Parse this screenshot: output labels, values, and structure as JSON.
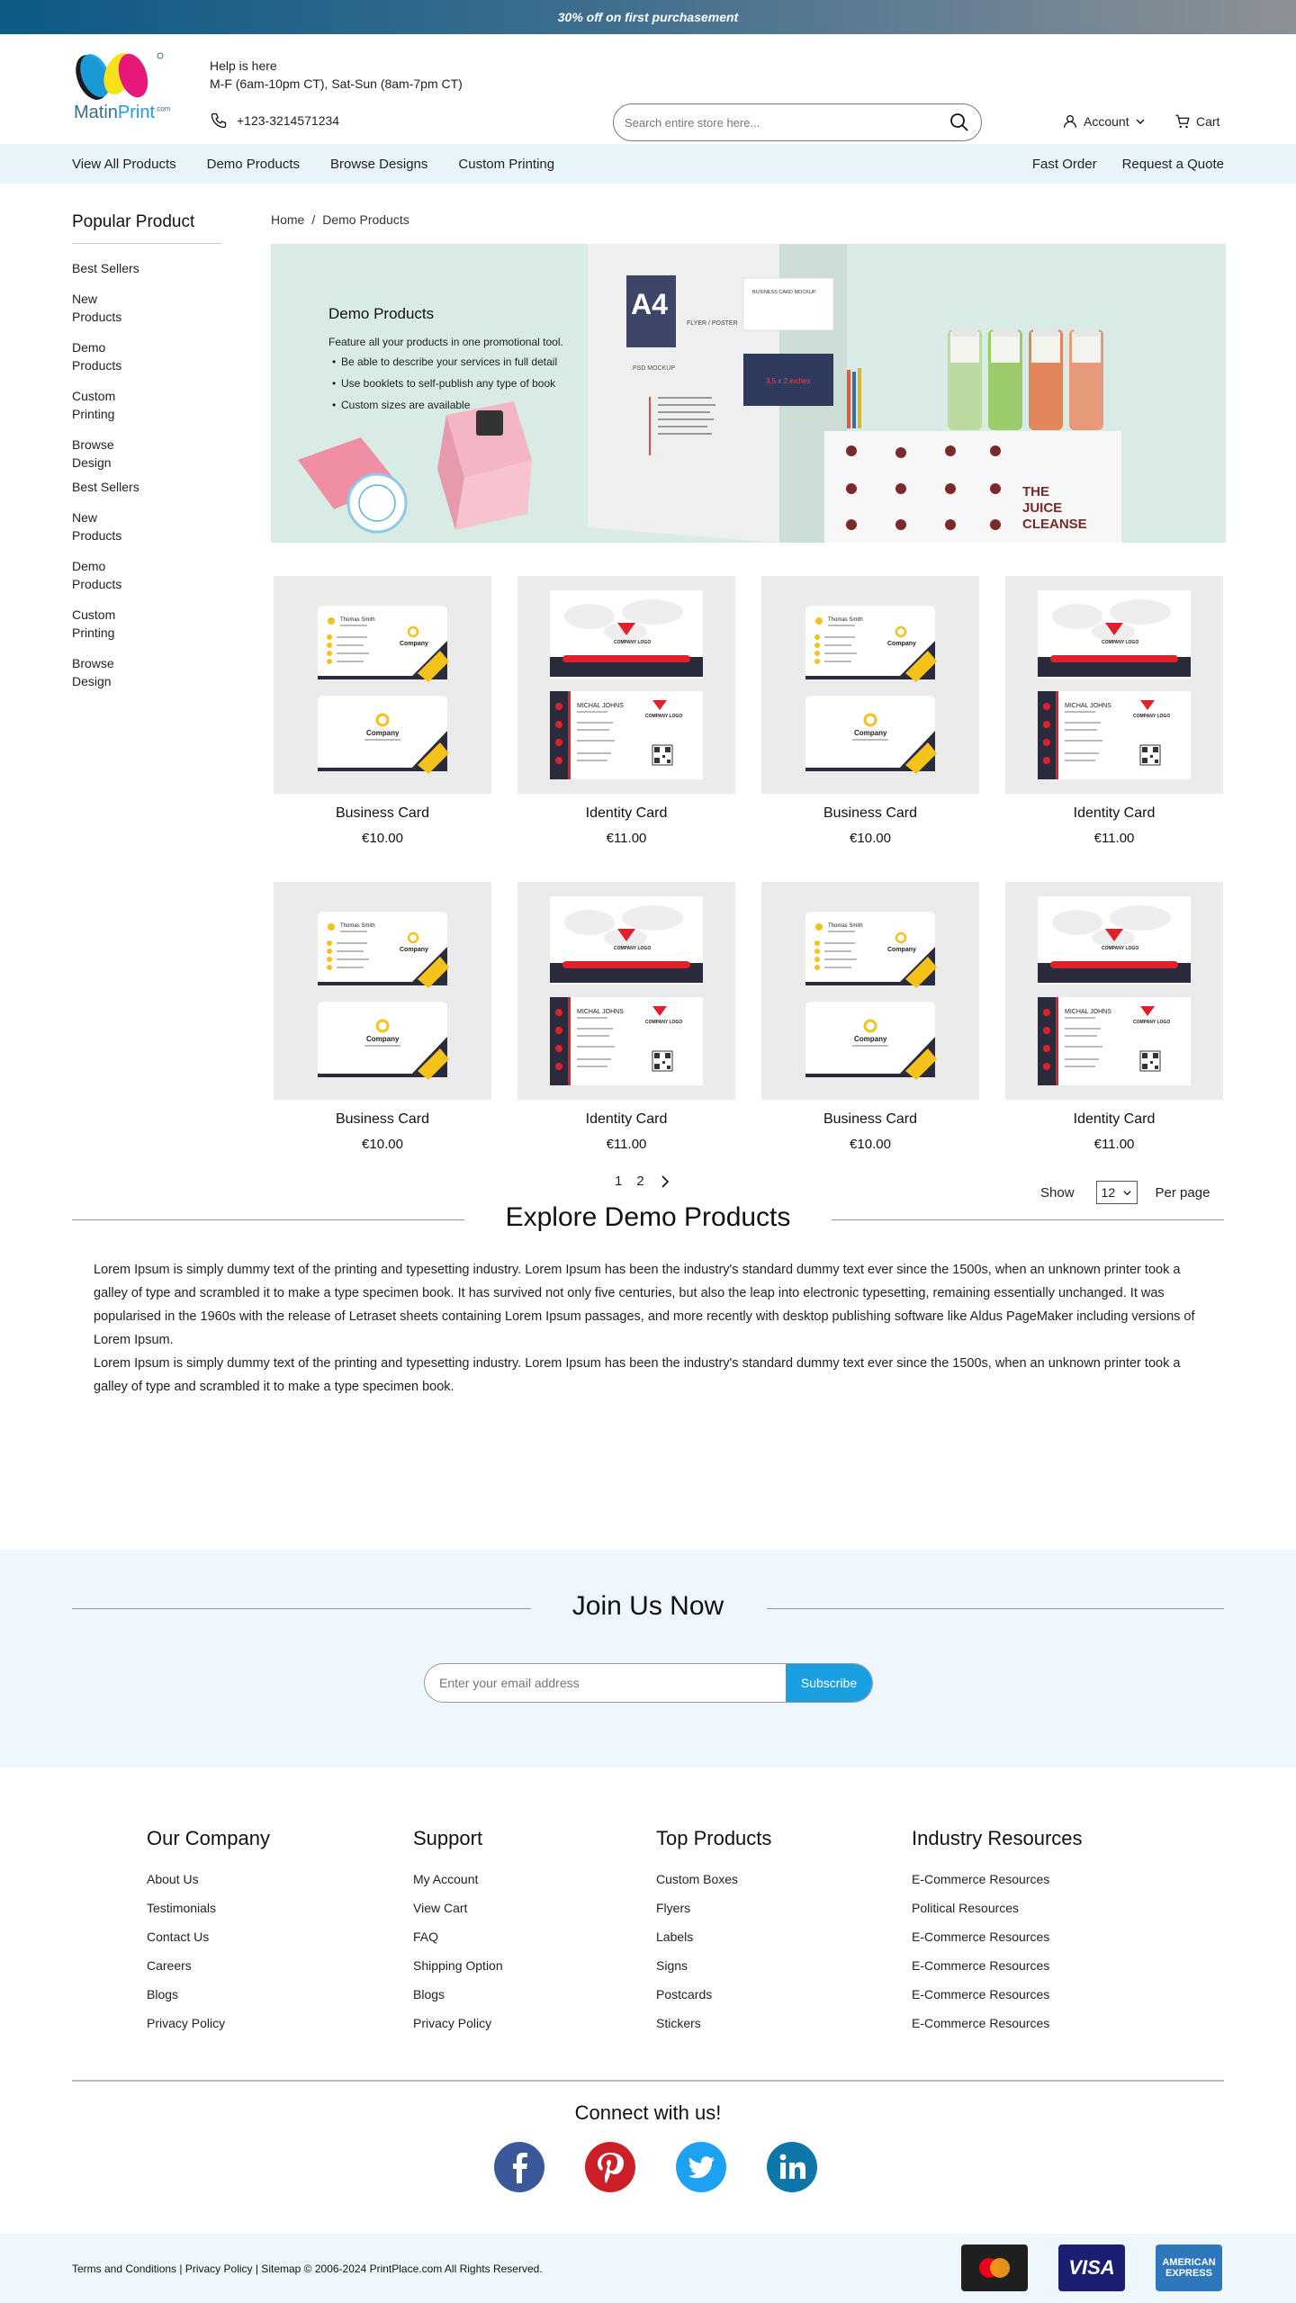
{
  "promo": {
    "text": "30% off on first purchasement"
  },
  "brand": {
    "logo_part1": "Matin",
    "logo_part2": "Print",
    "logo_tag": ".com"
  },
  "help": {
    "title": "Help is here",
    "hours": "M-F (6am-10pm CT), Sat-Sun (8am-7pm CT)",
    "phone": "+123-3214571234"
  },
  "search": {
    "placeholder": "Search entire store here...",
    "icon": "search-icon"
  },
  "header": {
    "account_label": "Account",
    "cart_label": "Cart"
  },
  "nav": {
    "left": [
      "View All Products",
      "Demo Products",
      "Browse Designs",
      "Custom Printing"
    ],
    "right": [
      "Fast Order",
      "Request a Quote"
    ]
  },
  "sidebar": {
    "title": "Popular Product",
    "items": [
      "Best Sellers",
      "New Products",
      "Demo Products",
      "Custom Printing",
      "Browse Design",
      "Best Sellers",
      "New Products",
      "Demo Products",
      "Custom Printing",
      "Browse Design"
    ]
  },
  "breadcrumb": {
    "home": "Home",
    "separator": "/",
    "current": "Demo Products"
  },
  "banner": {
    "title": "Demo Products",
    "intro": "Feature all your products in one promotional tool.",
    "bullets": [
      "Be able to describe your services in full detail",
      "Use booklets to self-publish any type of book",
      "Custom sizes are available"
    ],
    "poster_a4": "A4",
    "poster_label": "FLYER / POSTER",
    "poster_mockup": ".PSD MOCKUP",
    "card_label": "BUSINESS CARD MOCKUP",
    "card_size": "3.5 x 2 inches",
    "juice_line1": "THE",
    "juice_line2": "JUICE",
    "juice_line3": "CLEANSE"
  },
  "products": [
    [
      {
        "name": "Business Card",
        "price": "€10.00",
        "type": "business"
      },
      {
        "name": "Identity Card",
        "price": "€11.00",
        "type": "identity"
      },
      {
        "name": "Business Card",
        "price": "€10.00",
        "type": "business"
      },
      {
        "name": "Identity Card",
        "price": "€11.00",
        "type": "identity"
      }
    ],
    [
      {
        "name": "Business Card",
        "price": "€10.00",
        "type": "business"
      },
      {
        "name": "Identity Card",
        "price": "€11.00",
        "type": "identity"
      },
      {
        "name": "Business Card",
        "price": "€10.00",
        "type": "business"
      },
      {
        "name": "Identity Card",
        "price": "€11.00",
        "type": "identity"
      }
    ]
  ],
  "card_text": {
    "person_bc": "Thomas Smith",
    "company": "Company",
    "person_ic": "MICHAL JOHNS",
    "company_logo": "COMPANY LOGO"
  },
  "pagination": {
    "pages": [
      "1",
      "2"
    ],
    "show_label": "Show",
    "per_page_value": "12",
    "per_page_label": "Per page"
  },
  "explore": {
    "title": "Explore Demo Products",
    "paragraphs": [
      "Lorem Ipsum is simply dummy text of the printing and typesetting industry. Lorem Ipsum has been the industry's standard dummy text ever since the 1500s, when an unknown printer took a galley of type and scrambled it to make a type specimen book. It has survived not only five centuries, but also the leap into electronic typesetting, remaining essentially unchanged. It was popularised in the 1960s with the release of Letraset sheets containing Lorem Ipsum passages, and more recently with desktop publishing software like Aldus PageMaker including versions of Lorem Ipsum.",
      "Lorem Ipsum is simply dummy text of the printing and typesetting industry. Lorem Ipsum has been the industry's standard dummy text ever since the 1500s, when an unknown printer took a galley of type and scrambled it to make a type specimen book."
    ]
  },
  "join": {
    "title": "Join Us Now",
    "placeholder": "Enter your email address",
    "button": "Subscribe"
  },
  "footer": {
    "columns": [
      {
        "title": "Our Company",
        "links": [
          "About Us",
          "Testimonials",
          "Contact Us",
          "Careers",
          "Blogs",
          "Privacy Policy"
        ]
      },
      {
        "title": "Support",
        "links": [
          "My Account",
          "View Cart",
          "FAQ",
          "Shipping Option",
          "Blogs",
          "Privacy Policy"
        ]
      },
      {
        "title": "Top Products",
        "links": [
          "Custom Boxes",
          "Flyers",
          "Labels",
          "Signs",
          "Postcards",
          "Stickers"
        ]
      },
      {
        "title": "Industry Resources",
        "links": [
          "E-Commerce Resources",
          "Political Resources",
          "E-Commerce Resources",
          "E-Commerce Resources",
          "E-Commerce Resources",
          "E-Commerce Resources"
        ]
      }
    ],
    "connect_title": "Connect with us!",
    "social": [
      "facebook-icon",
      "pinterest-icon",
      "twitter-icon",
      "linkedin-icon"
    ],
    "legal": "Terms and Conditions | Privacy Policy | Sitemap © 2006-2024 PrintPlace.com All Rights Reserved.",
    "payments": {
      "visa": "VISA",
      "amex_line1": "AMERICAN",
      "amex_line2": "EXPRESS"
    }
  },
  "colors": {
    "accent": "#1aa0e0",
    "nav_bg": "#e8f5fb",
    "banner_bg": "#d8ebe4",
    "card_yellow": "#f5c21b",
    "card_red": "#e0202a",
    "card_navy": "#2a2c3e"
  }
}
